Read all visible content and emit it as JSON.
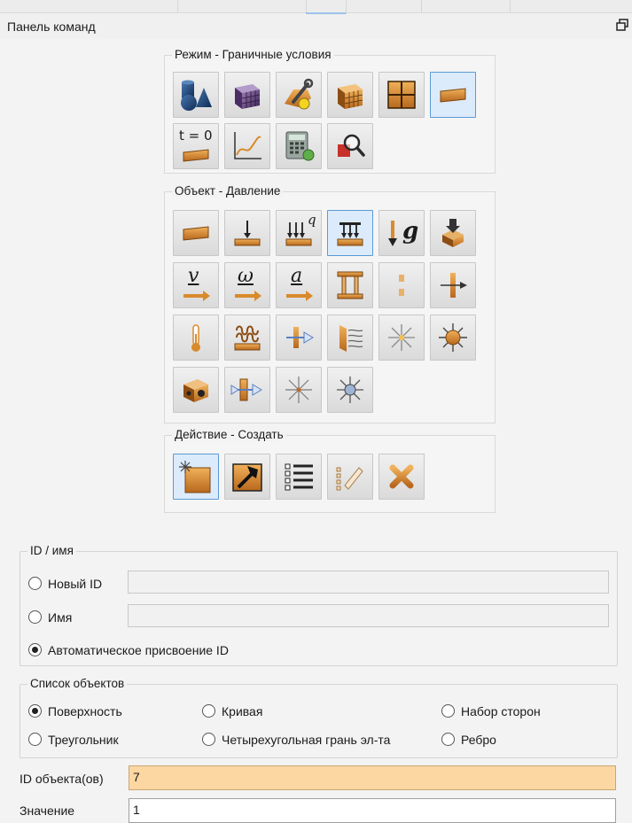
{
  "panel": {
    "title": "Панель команд"
  },
  "mode": {
    "title": "Режим - Граничные условия",
    "buttons": [
      {
        "icon": "geometry-icon"
      },
      {
        "icon": "mesh-icon"
      },
      {
        "icon": "properties-icon"
      },
      {
        "icon": "element-mesh-icon"
      },
      {
        "icon": "grid-icon"
      },
      {
        "icon": "boundary-conditions-icon",
        "active": true
      },
      {
        "icon": "initial-conditions-icon",
        "label": "t = 0"
      },
      {
        "icon": "xy-plot-icon"
      },
      {
        "icon": "calculator-icon"
      },
      {
        "icon": "magnify-icon"
      }
    ]
  },
  "object": {
    "title": "Объект - Давление",
    "q_label": "q",
    "g_label": "g",
    "v_label": "v",
    "w_label": "ω",
    "a_label": "a"
  },
  "action": {
    "title": "Действие - Создать"
  },
  "id_group": {
    "legend": "ID / имя",
    "new_id_label": "Новый ID",
    "new_id_value": "",
    "name_label": "Имя",
    "name_value": "",
    "auto_label": "Автоматическое присвоение ID",
    "selected": "auto"
  },
  "object_list": {
    "legend": "Список объектов",
    "options": [
      {
        "label": "Поверхность",
        "selected": true
      },
      {
        "label": "Кривая",
        "selected": false
      },
      {
        "label": "Набор сторон",
        "selected": false
      },
      {
        "label": "Треугольник",
        "selected": false
      },
      {
        "label": "Четырехугольная грань эл-та",
        "selected": false
      },
      {
        "label": "Ребро",
        "selected": false
      }
    ]
  },
  "fields": {
    "object_ids_label": "ID объекта(ов)",
    "object_ids_value": "7",
    "value_label": "Значение",
    "value_value": "1"
  },
  "colors": {
    "accent": "#fdd7a1",
    "active_border": "#5a9ad6",
    "icon_orange": "#d98a2b"
  }
}
